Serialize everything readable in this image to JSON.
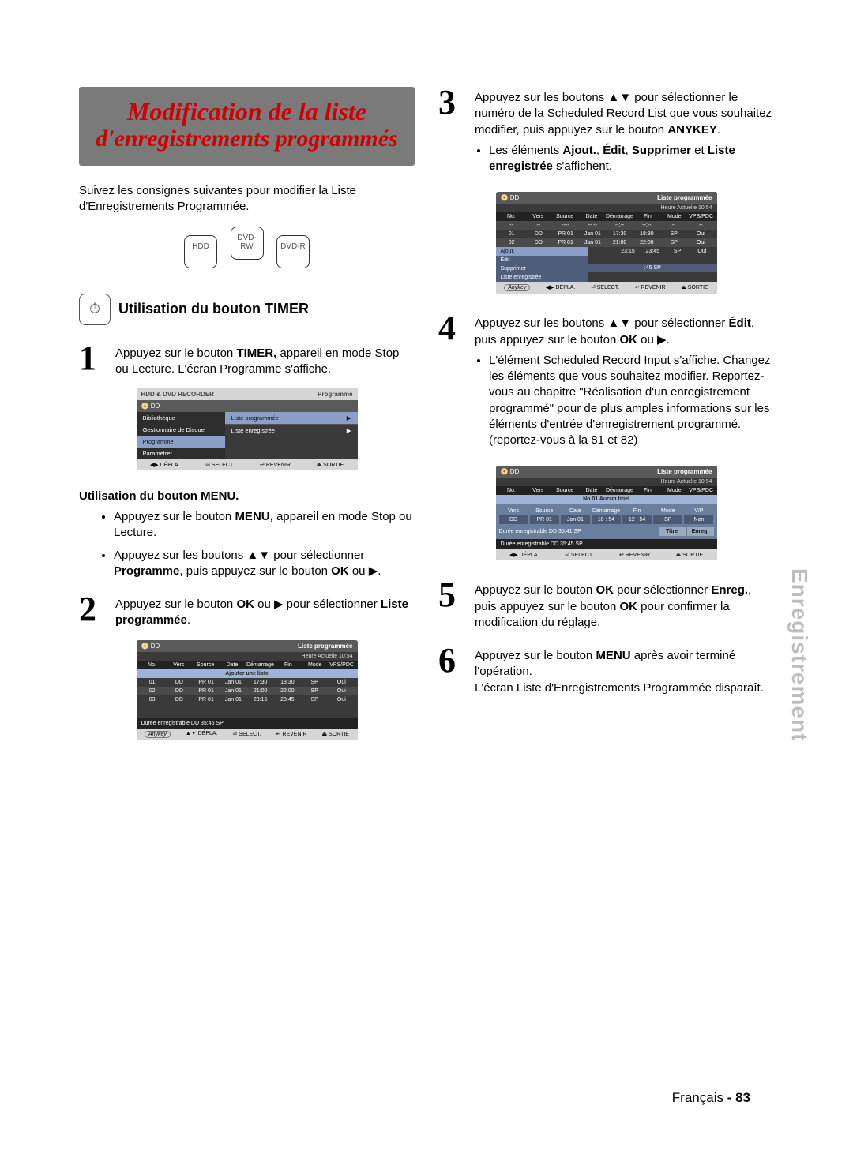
{
  "sideTab": "Enregistrement",
  "title": {
    "line1": "Modification de la liste",
    "line2": "d'enregistrements programmés"
  },
  "intro": "Suivez les consignes suivantes pour modifier la Liste d'Enregistrements Programmée.",
  "discs": [
    "HDD",
    "DVD-RW",
    "DVD-R"
  ],
  "section": {
    "title": "Utilisation du bouton TIMER",
    "icon": "⏱"
  },
  "step1": {
    "num": "1",
    "pre": "Appuyez sur le bouton ",
    "bold": "TIMER,",
    "post": " appareil en mode Stop ou Lecture. L'écran Programme s'affiche."
  },
  "osd1": {
    "hdrL": "HDD & DVD RECORDER",
    "hdrR": "Programme",
    "dd": "DD",
    "leftItems": [
      "Bibliothèque",
      "Gestionnaire de Disque",
      "Programme",
      "Paramétrer"
    ],
    "rightItems": [
      "Liste programmée",
      "Liste enregistrée"
    ],
    "ftr": [
      "◀▶ DÉPLA.",
      "⏎ SELECT.",
      "↩ REVENIR",
      "⏏ SORTIE"
    ]
  },
  "menuBlock": {
    "head": "Utilisation du bouton MENU.",
    "b1a": "Appuyez sur le bouton ",
    "b1b": "MENU",
    "b1c": ", appareil en mode Stop ou Lecture.",
    "b2a": "Appuyez sur les boutons ▲▼ pour sélectionner ",
    "b2b": "Programme",
    "b2c": ", puis appuyez sur le bouton ",
    "b2d": "OK",
    "b2e": " ou ▶."
  },
  "step2": {
    "num": "2",
    "pre": "Appuyez sur le bouton ",
    "b1": "OK",
    "mid": " ou ▶ pour sélectionner ",
    "b2": "Liste programmée",
    "post": "."
  },
  "osd2": {
    "dd": "DD",
    "title": "Liste programmée",
    "time": "Heure Actuelle 10:54",
    "cols": [
      "No.",
      "Vers",
      "Source",
      "Date",
      "Démarrage",
      "Fin",
      "Mode",
      "VPS/PDC"
    ],
    "addRow": "Ajouter une liste",
    "rows": [
      [
        "01",
        "DD",
        "PR 01",
        "Jan 01",
        "17:30",
        "18:30",
        "SP",
        "Oui"
      ],
      [
        "02",
        "DD",
        "PR 01",
        "Jan 01",
        "21:00",
        "22:00",
        "SP",
        "Oui"
      ],
      [
        "03",
        "DD",
        "PR 01",
        "Jan 01",
        "23:15",
        "23:45",
        "SP",
        "Oui"
      ]
    ],
    "dur": "Durée enregistrable    DD  35:45 SP",
    "ftrAnykey": "Anykey",
    "ftr": [
      "▲▼ DÉPLA.",
      "⏎ SELECT.",
      "↩ REVENIR",
      "⏏ SORTIE"
    ]
  },
  "step3": {
    "num": "3",
    "pre": "Appuyez sur les boutons ▲▼ pour sélectionner le numéro de la Scheduled Record List que vous souhaitez modifier, puis appuyez sur le bouton ",
    "b1": "ANYKEY",
    "post1": ".",
    "bul_pre": "Les éléments ",
    "bA": "Ajout.",
    "sep1": ", ",
    "bB": "Édit",
    "sep2": ", ",
    "bC": "Supprimer",
    "sep3": " et ",
    "bD": "Liste enregistrée",
    "bul_post": " s'affichent."
  },
  "osd3": {
    "dd": "DD",
    "title": "Liste programmée",
    "time": "Heure Actuelle 10:54",
    "cols": [
      "No.",
      "Vers",
      "Source",
      "Date",
      "Démarrage",
      "Fin",
      "Mode",
      "VPS/PDC"
    ],
    "dashRow": [
      "--",
      "--",
      "----",
      "-- --",
      "--:--",
      "--:--",
      "--",
      "--"
    ],
    "rows": [
      [
        "01",
        "DD",
        "PR 01",
        "Jan 01",
        "17:30",
        "18:30",
        "SP",
        "Oui"
      ],
      [
        "02",
        "DD",
        "PR 01",
        "Jan 01",
        "21:00",
        "22:00",
        "SP",
        "Oui"
      ]
    ],
    "ctx": [
      "Ajout.",
      "Édit",
      "Supprimer",
      "Liste enregistrée"
    ],
    "ctxExtra": [
      "23:15",
      "23:45",
      "SP",
      "Oui"
    ],
    "ctxDur": ":45 SP",
    "ftrAnykey": "Anykey",
    "ftr": [
      "◀▶ DÉPLA.",
      "⏎ SELECT.",
      "↩ REVENIR",
      "⏏ SORTIE"
    ]
  },
  "step4": {
    "num": "4",
    "l1a": "Appuyez sur les boutons ▲▼ pour sélectionner ",
    "l1b": "Édit",
    "l1c": ", puis appuyez sur le bouton ",
    "l1d": "OK",
    "l1e": " ou ▶.",
    "bul": "L'élément Scheduled Record Input s'affiche. Changez les éléments que vous souhaitez modifier. Reportez-vous au chapitre \"Réalisation d'un enregistrement programmé\" pour de plus amples informations sur les éléments d'entrée d'enregistrement programmé.(reportez-vous à la 81 et 82)"
  },
  "osd4": {
    "dd": "DD",
    "title": "Liste programmée",
    "time": "Heure Actuelle 10:54",
    "cols": [
      "No.",
      "Vers",
      "Source",
      "Date",
      "Démarrage",
      "Fin",
      "Mode",
      "VPS/PDC"
    ],
    "banner": "No.01 Aucun titiel",
    "inCols": [
      "Vers",
      "Source",
      "Date",
      "Démarrage",
      "Fin",
      "Mode",
      "V/P"
    ],
    "inVals": [
      "DD",
      "PR 01",
      "Jan 01",
      "10 : 54",
      "12 : 54",
      "SP",
      "Non"
    ],
    "innerDur": "Durée enregistrable   DD   35:41 SP",
    "btns": [
      "Titre",
      "Enreg."
    ],
    "dur": "Durée enregistrable  DD       35:45 SP",
    "ftr": [
      "◀▶ DÉPLA.",
      "⏎ SELECT.",
      "↩ REVENIR",
      "⏏ SORTIE"
    ]
  },
  "step5": {
    "num": "5",
    "a": "Appuyez sur le bouton ",
    "b1": "OK",
    "b": " pour sélectionner ",
    "b2": "Enreg.",
    "c": ", puis appuyez sur le bouton ",
    "b3": "OK",
    "d": " pour confirmer la modification du réglage."
  },
  "step6": {
    "num": "6",
    "a": "Appuyez sur le bouton ",
    "b1": "MENU",
    "b": " après avoir terminé l'opération.",
    "c": "L'écran Liste d'Enregistrements Programmée disparaît."
  },
  "footer": {
    "lang": "Français",
    "sep": " - ",
    "page": "83"
  }
}
